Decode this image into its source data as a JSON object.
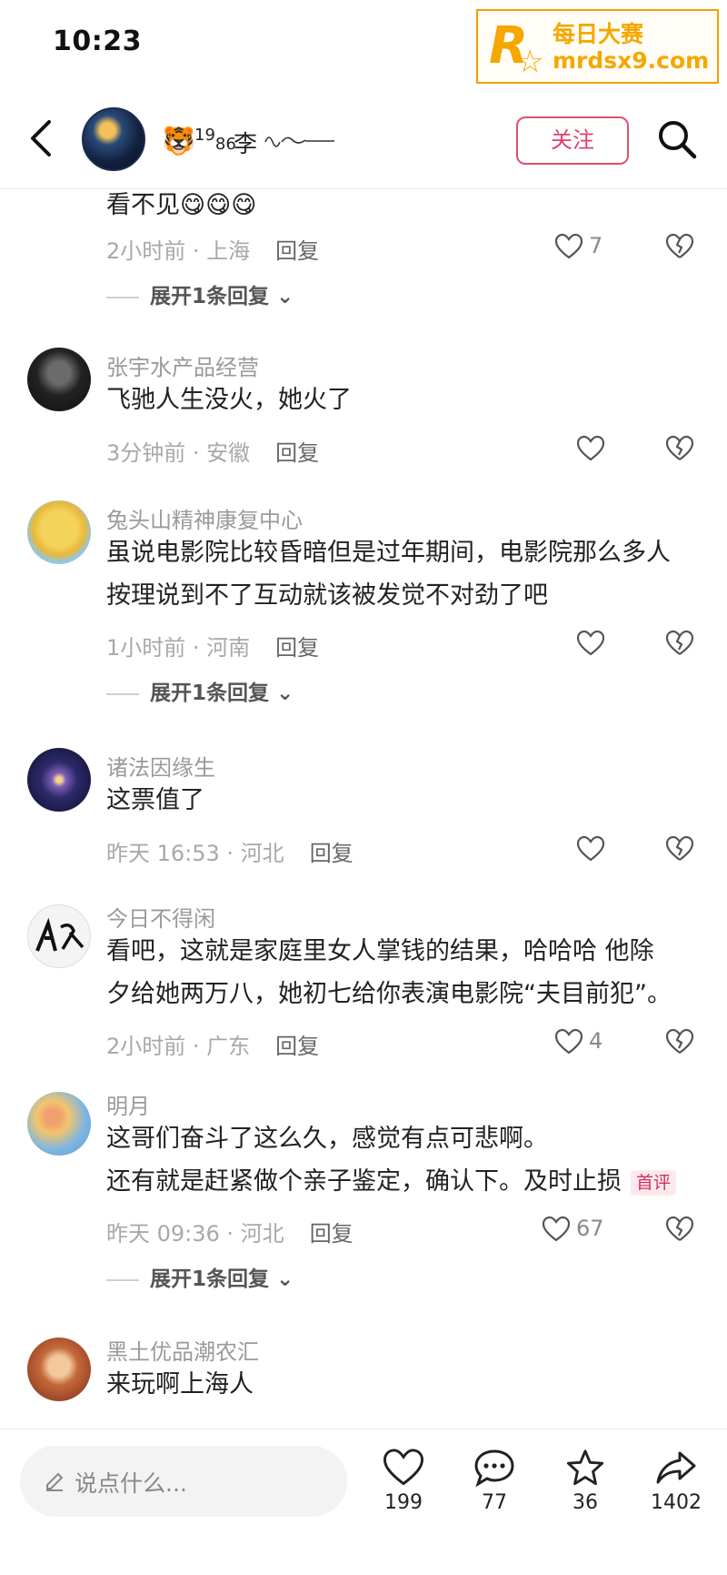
{
  "status_bar": {
    "time": "10:23"
  },
  "watermark": {
    "line1": "每日大赛",
    "line2": "mrdsx9.com",
    "logo_letter": "R"
  },
  "header": {
    "user_badge_nums_top": "19",
    "user_badge_nums_bottom": "86",
    "user_name": "李",
    "follow_label": "关注"
  },
  "comments": [
    {
      "user": "",
      "text": "看不见😋😋😋",
      "time_loc": "2小时前 · 上海",
      "reply": "回复",
      "likes": "7",
      "expand": "展开1条回复"
    },
    {
      "user": "张宇水产品经营",
      "text": "飞驰人生没火，她火了",
      "time_loc": "3分钟前 · 安徽",
      "reply": "回复",
      "likes": ""
    },
    {
      "user": "兔头山精神康复中心",
      "text_line1": "虽说电影院比较昏暗但是过年期间，电影院那么多人",
      "text_line2": "按理说到不了互动就该被发觉不对劲了吧",
      "time_loc": "1小时前 · 河南",
      "reply": "回复",
      "likes": "",
      "expand": "展开1条回复"
    },
    {
      "user": "诸法因缘生",
      "text": "这票值了",
      "time_loc": "昨天 16:53 · 河北",
      "reply": "回复",
      "likes": ""
    },
    {
      "user": "今日不得闲",
      "text_line1": "看吧，这就是家庭里女人掌钱的结果，哈哈哈  他除",
      "text_line2": "夕给她两万八，她初七给你表演电影院“夫目前犯”。",
      "time_loc": "2小时前 · 广东",
      "reply": "回复",
      "likes": "4"
    },
    {
      "user": "明月",
      "text_line1": "这哥们奋斗了这么久，感觉有点可悲啊。",
      "text_line2": "还有就是赶紧做个亲子鉴定，确认下。及时止损",
      "badge": "首评",
      "time_loc": "昨天 09:36 · 河北",
      "reply": "回复",
      "likes": "67",
      "expand": "展开1条回复"
    },
    {
      "user": "黑土优品潮农汇",
      "text": "来玩啊上海人"
    }
  ],
  "bottom_bar": {
    "input_placeholder": "说点什么...",
    "like_count": "199",
    "comment_count": "77",
    "favorite_count": "36",
    "share_count": "1402"
  },
  "colors": {
    "accent": "#e0406a",
    "watermark": "#f5a700"
  }
}
